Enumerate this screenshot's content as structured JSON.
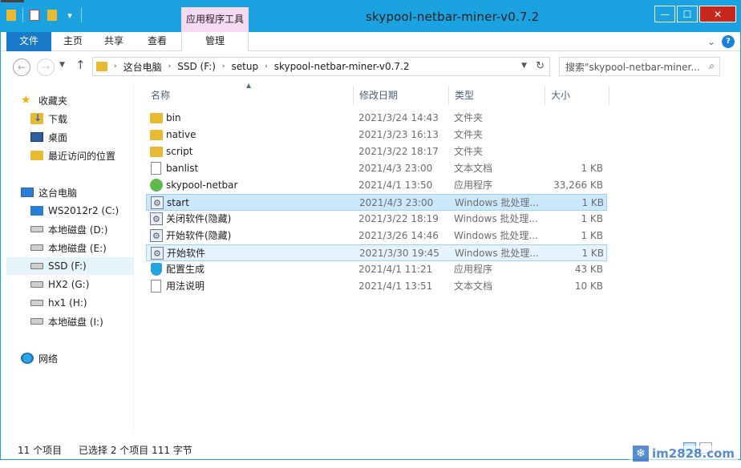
{
  "titlebar": {
    "title": "skypool-netbar-miner-v0.7.2",
    "context_tab_group": "应用程序工具",
    "min_glyph": "—",
    "max_glyph": "☐",
    "close_glyph": "✕"
  },
  "ribbon": {
    "file": "文件",
    "home": "主页",
    "share": "共享",
    "view": "查看",
    "manage": "管理",
    "expand_glyph": "⌄",
    "help_glyph": "?"
  },
  "nav": {
    "back": "←",
    "forward": "→",
    "recent": "▼",
    "up": "↑"
  },
  "address": {
    "crumbs": [
      "这台电脑",
      "SSD (F:)",
      "setup",
      "skypool-netbar-miner-v0.7.2"
    ],
    "sep": "›",
    "drop": "▼",
    "refresh": "↻"
  },
  "search": {
    "placeholder": "搜索\"skypool-netbar-miner...",
    "icon": "⌕"
  },
  "navpane": {
    "favorites": "收藏夹",
    "downloads": "下载",
    "desktop": "桌面",
    "recent": "最近访问的位置",
    "thispc": "这台电脑",
    "drives": [
      "WS2012r2 (C:)",
      "本地磁盘 (D:)",
      "本地磁盘 (E:)",
      "SSD (F:)",
      "HX2 (G:)",
      "hx1 (H:)",
      "本地磁盘 (I:)"
    ],
    "network": "网络"
  },
  "columns": {
    "sort_glyph": "▲",
    "name": "名称",
    "date": "修改日期",
    "type": "类型",
    "size": "大小"
  },
  "files": [
    {
      "name": "bin",
      "date": "2021/3/24 14:43",
      "type": "文件夹",
      "size": "",
      "icon": "folder-icon"
    },
    {
      "name": "native",
      "date": "2021/3/23 16:13",
      "type": "文件夹",
      "size": "",
      "icon": "folder-icon"
    },
    {
      "name": "script",
      "date": "2021/3/22 18:17",
      "type": "文件夹",
      "size": "",
      "icon": "folder-icon"
    },
    {
      "name": "banlist",
      "date": "2021/4/3 23:00",
      "type": "文本文档",
      "size": "1 KB",
      "icon": "text-file-icon"
    },
    {
      "name": "skypool-netbar",
      "date": "2021/4/1 13:50",
      "type": "应用程序",
      "size": "33,266 KB",
      "icon": "app-icon"
    },
    {
      "name": "start",
      "date": "2021/4/3 23:00",
      "type": "Windows 批处理...",
      "size": "1 KB",
      "icon": "batch-file-icon"
    },
    {
      "name": "关闭软件(隐藏)",
      "date": "2021/3/22 18:19",
      "type": "Windows 批处理...",
      "size": "1 KB",
      "icon": "batch-file-icon"
    },
    {
      "name": "开始软件(隐藏)",
      "date": "2021/3/26 14:46",
      "type": "Windows 批处理...",
      "size": "1 KB",
      "icon": "batch-file-icon"
    },
    {
      "name": "开始软件",
      "date": "2021/3/30 19:45",
      "type": "Windows 批处理...",
      "size": "1 KB",
      "icon": "batch-file-icon"
    },
    {
      "name": "配置生成",
      "date": "2021/4/1 11:21",
      "type": "应用程序",
      "size": "43 KB",
      "icon": "shield-app-icon"
    },
    {
      "name": "用法说明",
      "date": "2021/4/1 13:51",
      "type": "文本文档",
      "size": "10 KB",
      "icon": "text-file-icon"
    }
  ],
  "status": {
    "count": "11 个项目",
    "selection": "已选择 2 个项目  111 字节"
  },
  "watermark": {
    "text": "im2828.com",
    "logo_glyph": "❄"
  }
}
